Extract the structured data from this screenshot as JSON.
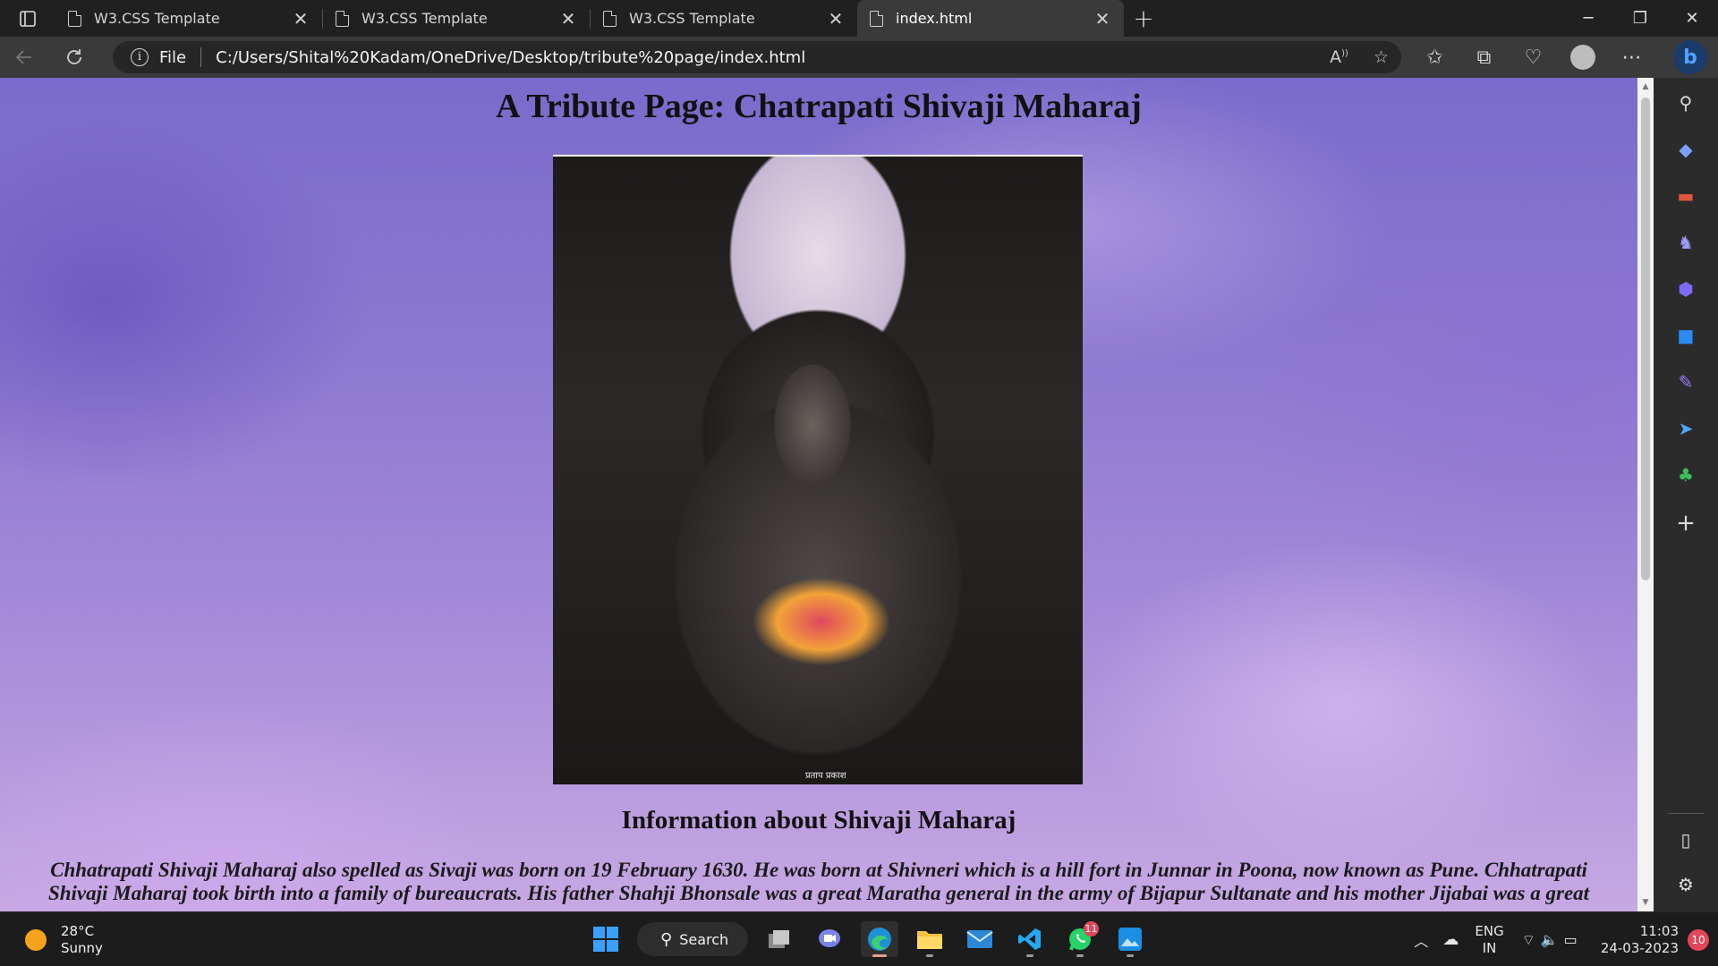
{
  "browser": {
    "tabs": [
      {
        "title": "W3.CSS Template",
        "active": false
      },
      {
        "title": "W3.CSS Template",
        "active": false
      },
      {
        "title": "W3.CSS Template",
        "active": false
      },
      {
        "title": "index.html",
        "active": true
      }
    ],
    "address": {
      "scheme_label": "File",
      "url": "C:/Users/Shital%20Kadam/OneDrive/Desktop/tribute%20page/index.html"
    }
  },
  "page": {
    "title": "A Tribute Page: Chatrapati Shivaji Maharaj",
    "image_caption": "प्रताप प्रकाश",
    "section_title": "Information about Shivaji Maharaj",
    "paragraph": "Chhatrapati Shivaji Maharaj also spelled as Sivaji was born on 19 February 1630. He was born at Shivneri which is a hill fort in Junnar in Poona, now known as Pune. Chhatrapati Shivaji Maharaj took birth into a family of bureaucrats. His father Shahji Bhonsale was a great Maratha general in the army of Bijapur Sultanate and his mother Jijabai was a great"
  },
  "taskbar": {
    "weather": {
      "temperature": "28°C",
      "condition": "Sunny"
    },
    "search_label": "Search",
    "whatsapp_badge": "11",
    "language": {
      "line1": "ENG",
      "line2": "IN"
    },
    "time": "11:03",
    "date": "24-03-2023",
    "notification_count": "10"
  },
  "colors": {
    "accent_edge_blue": "#3aa0ff",
    "badge_red": "#e3465b"
  }
}
